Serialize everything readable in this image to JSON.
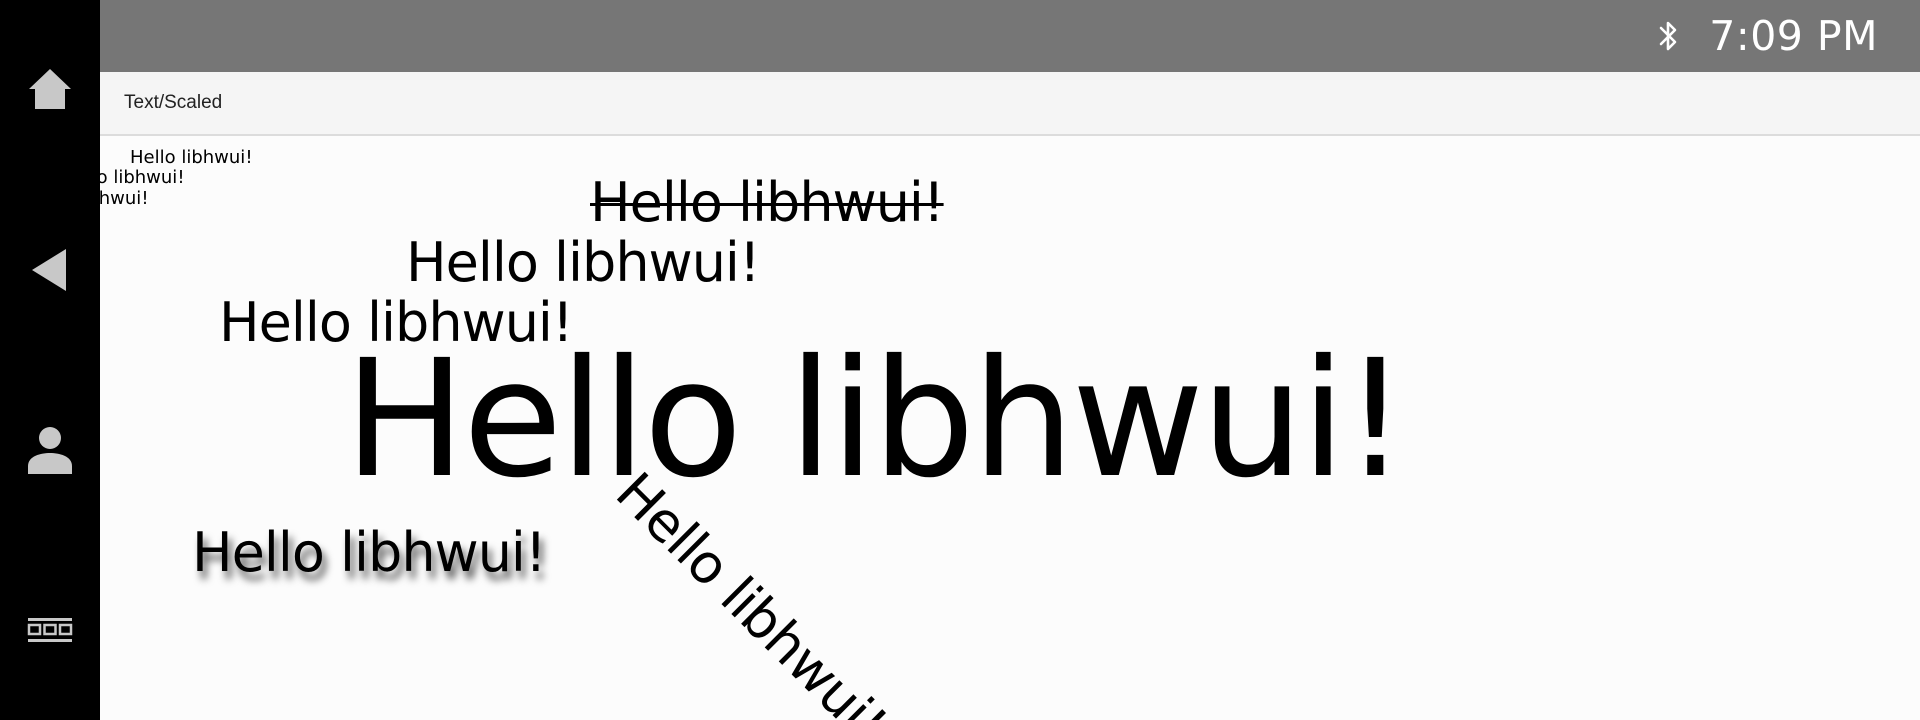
{
  "nav_rail": {
    "items": [
      {
        "name": "home",
        "icon": "home-icon"
      },
      {
        "name": "back",
        "icon": "back-icon"
      },
      {
        "name": "user",
        "icon": "user-icon"
      },
      {
        "name": "apps",
        "icon": "app-grid-icon"
      }
    ]
  },
  "status_bar": {
    "bluetooth_icon": "bluetooth-icon",
    "time": "7:09 PM"
  },
  "title_bar": {
    "title": "Text/Scaled"
  },
  "canvas": {
    "samples": [
      {
        "text": "Hello libhwui!",
        "style": "small"
      },
      {
        "text": "Hello libhwui!",
        "style": "small-clipped"
      },
      {
        "text": "Hello libhwui!",
        "style": "small-clipped"
      },
      {
        "text": "Hello libhwui!",
        "style": "strikethrough"
      },
      {
        "text": "Hello libhwui!",
        "style": "normal"
      },
      {
        "text": "Hello libhwui!",
        "style": "normal"
      },
      {
        "text": "Hello libhwui!",
        "style": "scaled-large"
      },
      {
        "text": "Hello libhwui!",
        "style": "shadow"
      },
      {
        "text": "Hello libhwui!",
        "style": "rotated"
      }
    ]
  },
  "colors": {
    "rail_background": "#000000",
    "status_bar_background": "#767676",
    "title_bar_background": "#f5f5f5",
    "canvas_background": "#fcfcfc",
    "icon_gray": "#c8c8c8"
  }
}
